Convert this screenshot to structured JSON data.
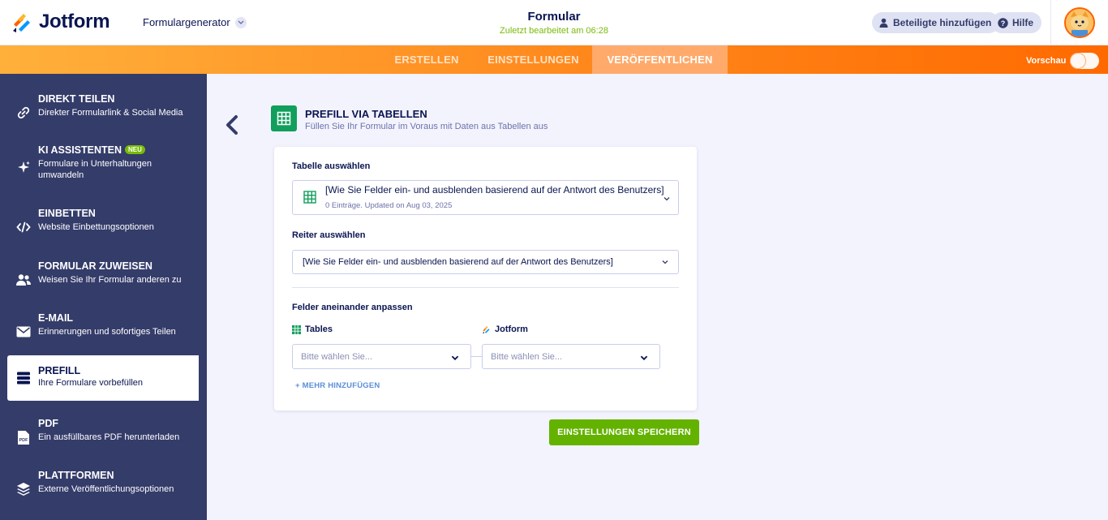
{
  "app": {
    "name": "Jotform",
    "generator": "Formulargenerator",
    "form_title": "Formular",
    "last_edited": "Zuletzt bearbeitet am 06:28",
    "add_participants": "Beteiligte hinzufügen",
    "help": "Hilfe"
  },
  "nav": {
    "tabs": [
      {
        "label": "ERSTELLEN"
      },
      {
        "label": "EINSTELLUNGEN"
      },
      {
        "label": "VERÖFFENTLICHEN"
      }
    ],
    "active_tab": "VERÖFFENTLICHEN",
    "preview_label": "Vorschau",
    "preview_on": false
  },
  "sidebar": {
    "items": [
      {
        "title": "DIREKT TEILEN",
        "desc": "Direkter Formularlink & Social Media",
        "icon": "link-icon"
      },
      {
        "title": "KI ASSISTENTEN",
        "badge": "NEU",
        "desc": "Formulare in Unterhaltungen umwandeln",
        "icon": "sparkle-icon"
      },
      {
        "title": "EINBETTEN",
        "desc": "Website Einbettungsoptionen",
        "icon": "code-icon"
      },
      {
        "title": "FORMULAR ZUWEISEN",
        "desc": "Weisen Sie Ihr Formular anderen zu",
        "icon": "users-icon"
      },
      {
        "title": "E-MAIL",
        "desc": "Erinnerungen und sofortiges Teilen",
        "icon": "envelope-icon"
      },
      {
        "title": "PREFILL",
        "desc": "Ihre Formulare vorbefüllen",
        "icon": "database-icon"
      },
      {
        "title": "PDF",
        "desc": "Ein ausfüllbares PDF herunterladen",
        "icon": "pdf-icon"
      },
      {
        "title": "PLATTFORMEN",
        "desc": "Externe Veröffentlichungsoptionen",
        "icon": "layers-icon"
      }
    ],
    "active": "PREFILL"
  },
  "main": {
    "section_title": "PREFILL VIA TABELLEN",
    "section_sub": "Füllen Sie Ihr Formular im Voraus mit Daten aus Tabellen aus",
    "table_label": "Tabelle auswählen",
    "table_value": "[Wie Sie Felder ein- und ausblenden basierend auf der Antwort des Benutzers]",
    "table_meta": "0 Einträge. Updated on Aug 03, 2025",
    "tab_label": "Reiter auswählen",
    "tab_value": "[Wie Sie Felder ein- und ausblenden basierend auf der Antwort des Benutzers]",
    "match_label": "Felder aneinander anpassen",
    "col_tables": "Tables",
    "col_jotform": "Jotform",
    "left_placeholder": "Bitte wählen Sie...",
    "right_placeholder": "Bitte wählen Sie...",
    "add_more": "+ MEHR HINZUFÜGEN",
    "save": "EINSTELLUNGEN SPEICHERN"
  },
  "colors": {
    "brand_orange": "#ff6100",
    "sidebar_bg": "#343c6a",
    "accent_green": "#64b200",
    "tables_green": "#109f5c"
  }
}
